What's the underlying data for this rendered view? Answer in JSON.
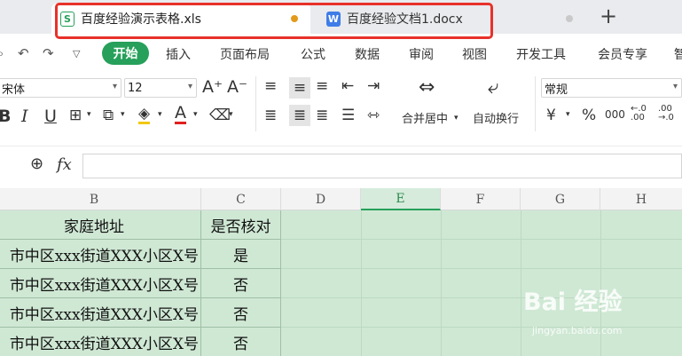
{
  "tabs": [
    {
      "label": "百度经验演示表格.xls",
      "icon": "S",
      "dot_color": "#e39a1b"
    },
    {
      "label": "百度经验文档1.docx",
      "icon": "W",
      "dot_color": "#c9c9c9"
    }
  ],
  "menu": {
    "start": "开始",
    "items": [
      "插入",
      "页面布局",
      "公式",
      "数据",
      "审阅",
      "视图",
      "开发工具",
      "会员专享",
      "智"
    ]
  },
  "toolbar": {
    "font_name": "宋体",
    "font_size": "12",
    "merge_center": "合并居中",
    "wrap_text": "自动换行",
    "number_format": "常规",
    "currency": "¥",
    "percent": "%",
    "thousands": "000",
    "inc_decimal": "←.0\n.00",
    "dec_decimal": ".00\n→.0"
  },
  "formula_bar": {
    "fx": "fx",
    "value": ""
  },
  "columns": [
    "B",
    "C",
    "D",
    "E",
    "F",
    "G",
    "H"
  ],
  "selected_column": "E",
  "headers": {
    "address": "家庭地址",
    "verified": "是否核对"
  },
  "rows": [
    {
      "address": "市中区xxx街道XXX小区X号",
      "verified": "是"
    },
    {
      "address": "市中区xxx街道XXX小区X号",
      "verified": "否"
    },
    {
      "address": "市中区xxx街道XXX小区X号",
      "verified": "否"
    },
    {
      "address": "市中区xxx街道XXX小区X号",
      "verified": "否"
    }
  ],
  "watermark": {
    "brand": "Bai 经验",
    "url": "jingyan.baidu.com"
  },
  "colors": {
    "accent": "#26a05a",
    "highlight": "#e8312a",
    "sheet_bg": "#cfe8d4"
  }
}
